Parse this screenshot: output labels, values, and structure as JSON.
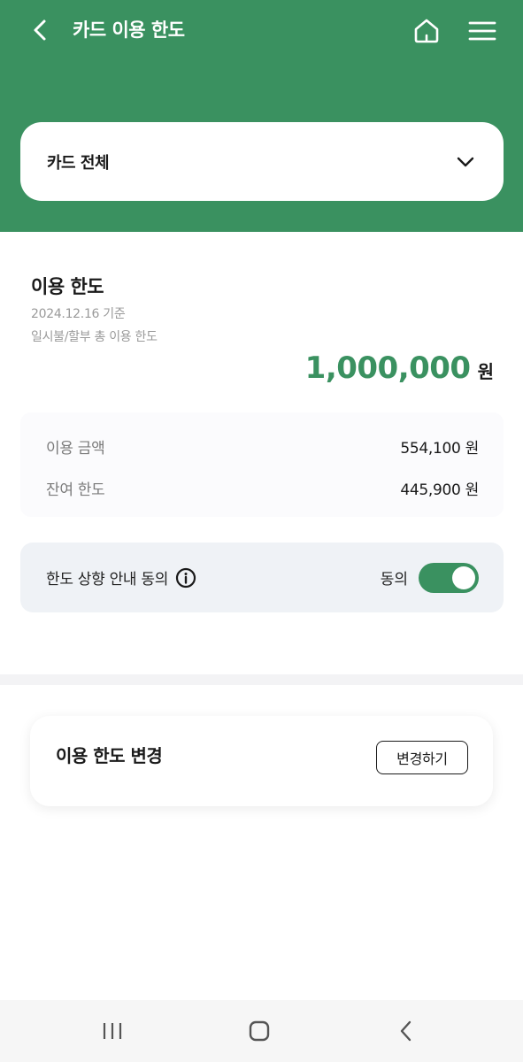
{
  "header": {
    "title": "카드 이용 한도",
    "icons": [
      "back-icon",
      "home-icon",
      "menu-icon"
    ],
    "color": "#3a9160"
  },
  "card_select": {
    "label": "카드 전체",
    "icon": "chevron-down-icon"
  },
  "limit": {
    "title": "이용 한도",
    "date": "2024.12.16 기준",
    "description": "일시불/할부 총 이용 한도",
    "amount": "1,000,000",
    "unit": "원"
  },
  "usage": {
    "rows": [
      {
        "label": "이용 금액",
        "value": "554,100 원"
      },
      {
        "label": "잔여 한도",
        "value": "445,900 원"
      }
    ]
  },
  "consent": {
    "label": "한도 상향 안내 동의",
    "agree_label": "동의",
    "toggle_on": true,
    "icon": "info-icon"
  },
  "change": {
    "title": "이용 한도 변경",
    "button_label": "변경하기"
  },
  "navbar": {
    "icons": [
      "recent-apps-icon",
      "home-nav-icon",
      "back-nav-icon"
    ]
  }
}
